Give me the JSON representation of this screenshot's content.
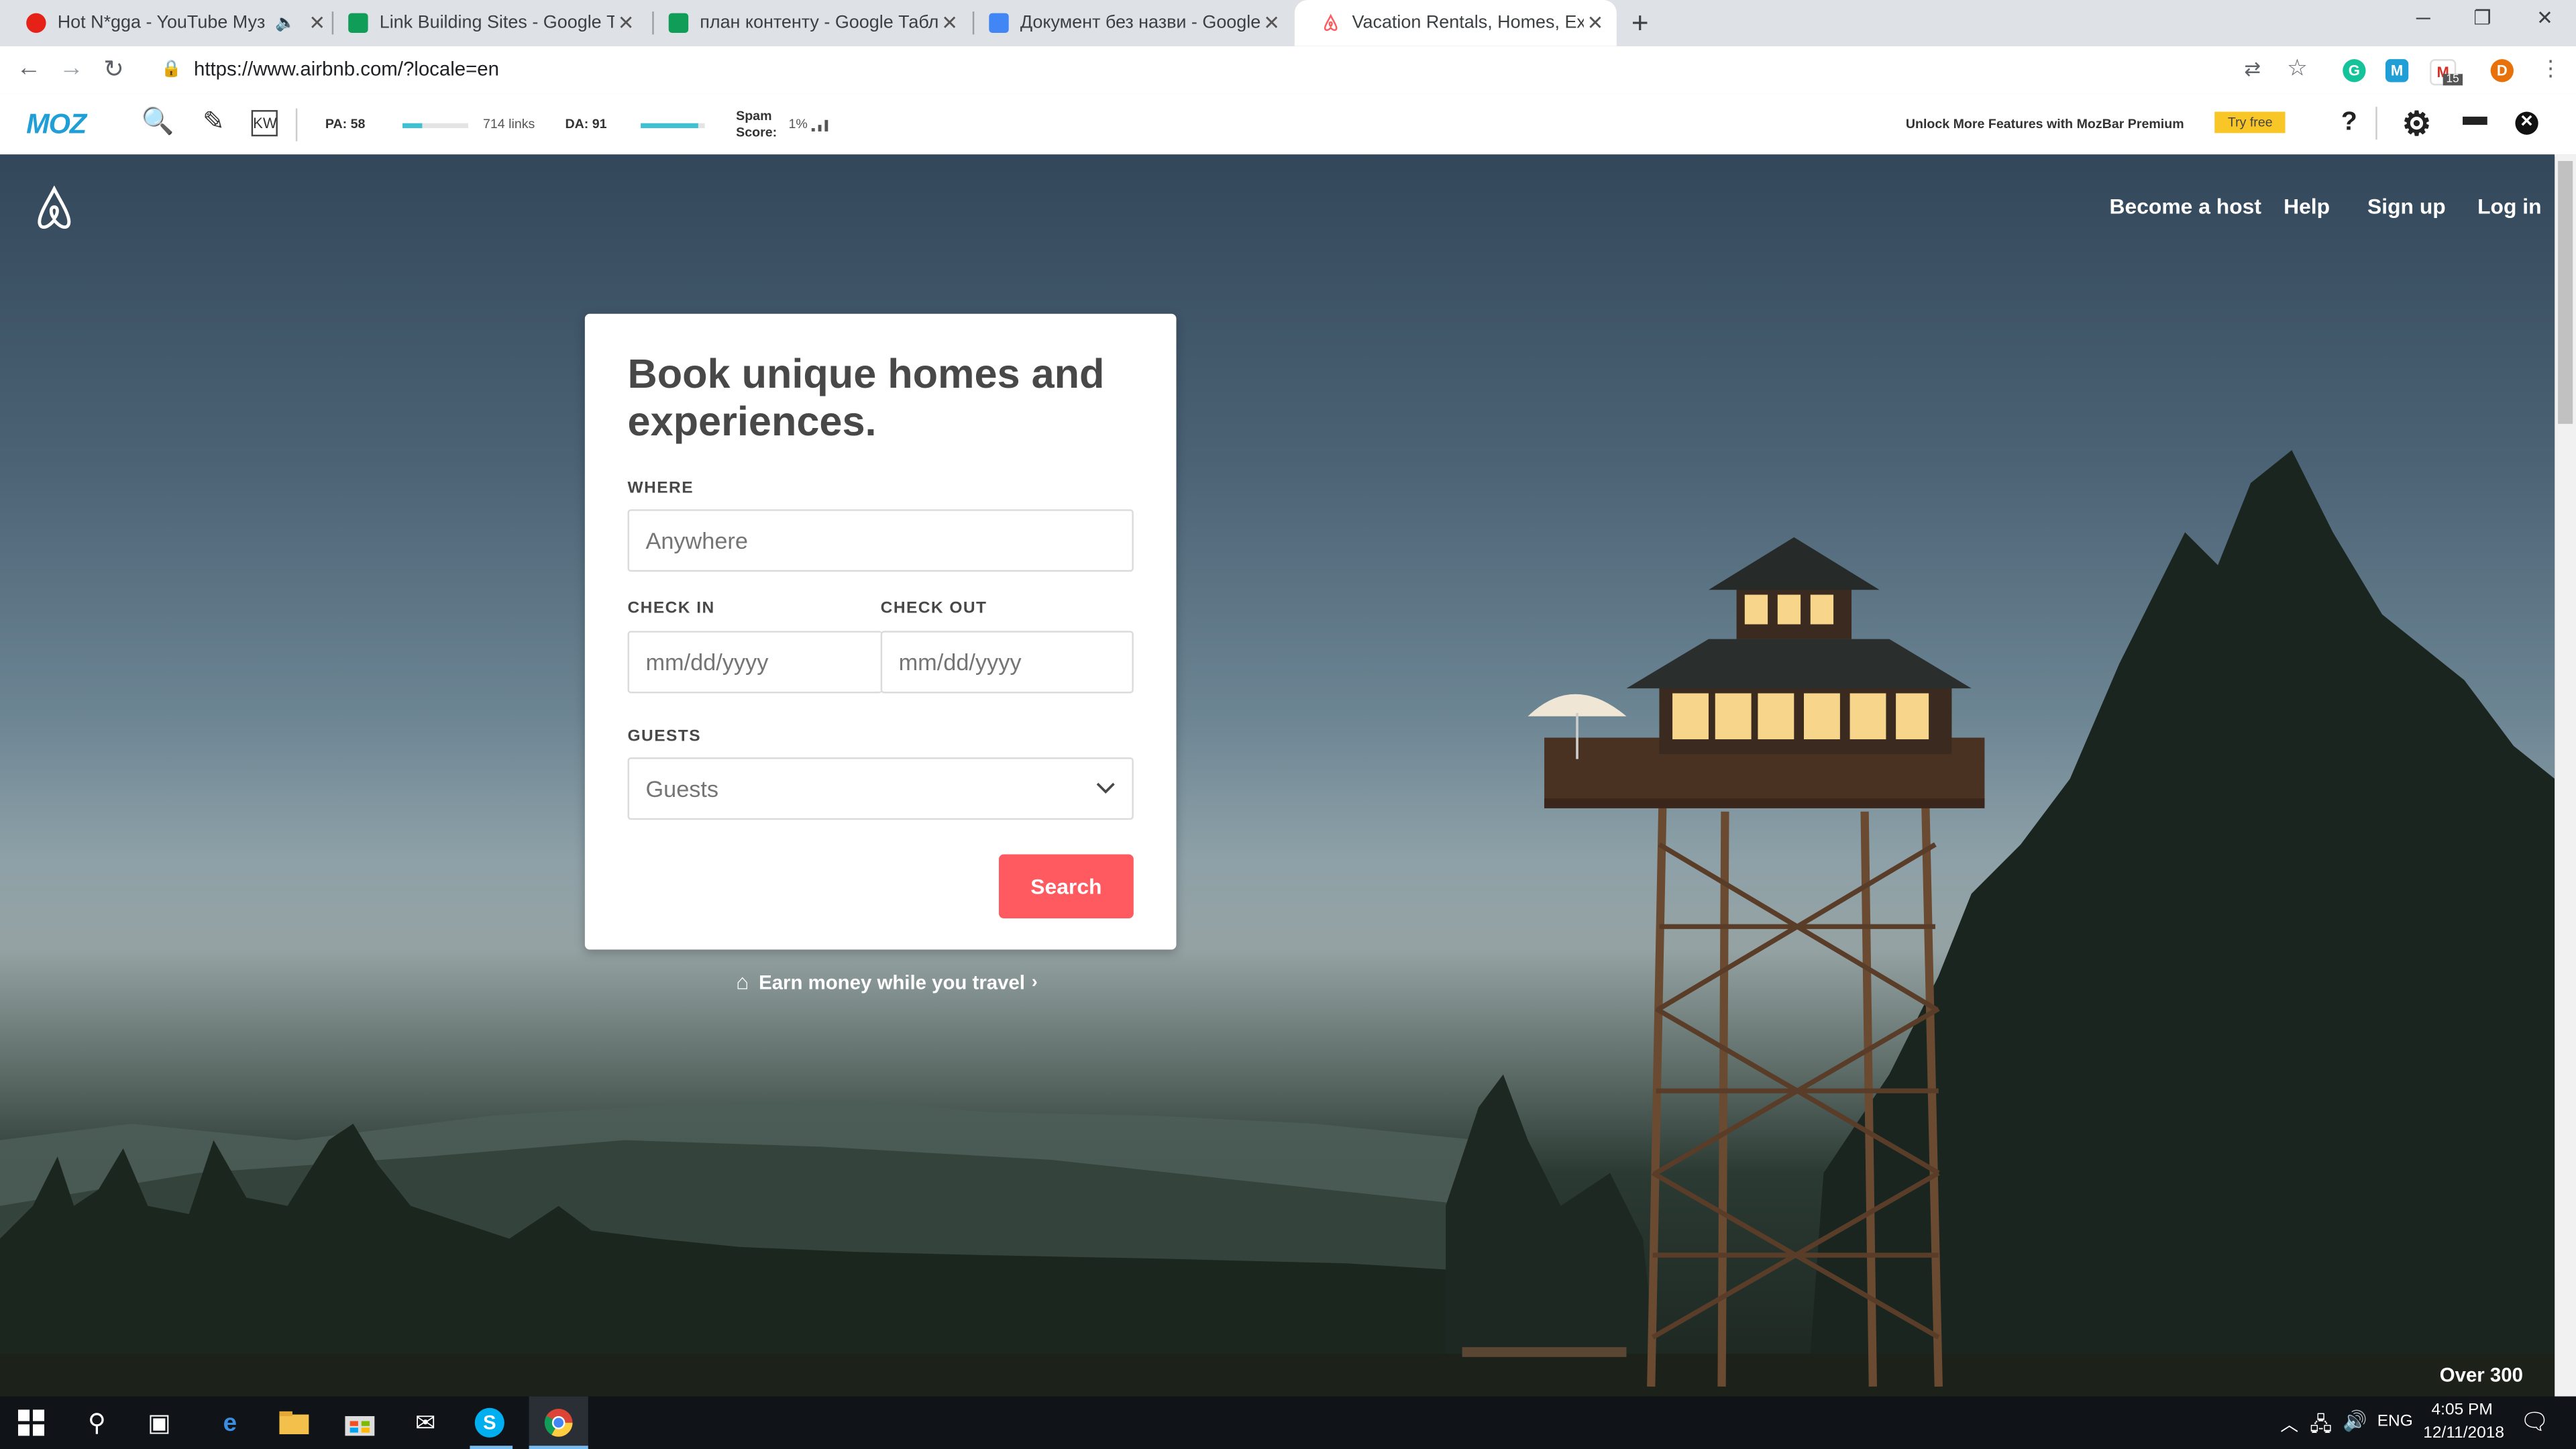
{
  "browser": {
    "tabs": [
      {
        "title": "Hot N*gga - YouTube Музыка",
        "favicon_color": "#e62117",
        "icon": "youtube-music-icon"
      },
      {
        "title": "Link Building Sites - Google Табли",
        "favicon_color": "#0f9d58",
        "icon": "google-sheets-icon"
      },
      {
        "title": "план контенту - Google Таблиці",
        "favicon_color": "#0f9d58",
        "icon": "google-sheets-icon"
      },
      {
        "title": "Документ без назви - Google Д",
        "favicon_color": "#4285f4",
        "icon": "google-docs-icon"
      },
      {
        "title": "Vacation Rentals, Homes, Experie",
        "favicon_color": "#ff5a5f",
        "icon": "airbnb-icon"
      }
    ],
    "url": "https://www.airbnb.com/?locale=en",
    "profile_initial": "D",
    "gmail_badge": "15"
  },
  "mozbar": {
    "logo": "MOZ",
    "pa_label": "PA: 58",
    "pa_level": 0.3,
    "links": "714 links",
    "da_label": "DA: 91",
    "da_level": 0.91,
    "spam_label_1": "Spam",
    "spam_label_2": "Score:",
    "spam_value": "1%",
    "premium_text": "Unlock More Features with MozBar Premium",
    "try_label": "Try free",
    "help_label": "?"
  },
  "page": {
    "nav": {
      "become_host": "Become a host",
      "help": "Help",
      "sign_up": "Sign up",
      "log_in": "Log in"
    },
    "card": {
      "heading": "Book unique homes and experiences.",
      "where_label": "WHERE",
      "where_placeholder": "Anywhere",
      "checkin_label": "CHECK IN",
      "checkout_label": "CHECK OUT",
      "date_placeholder": "mm/dd/yyyy",
      "guests_label": "GUESTS",
      "guests_value": "Guests",
      "search_label": "Search"
    },
    "earn_text": "Earn money while you travel",
    "over_300": "Over 300",
    "accent_color": "#ff5a5f"
  },
  "taskbar": {
    "language": "ENG",
    "time": "4:05 PM",
    "date": "12/11/2018"
  }
}
